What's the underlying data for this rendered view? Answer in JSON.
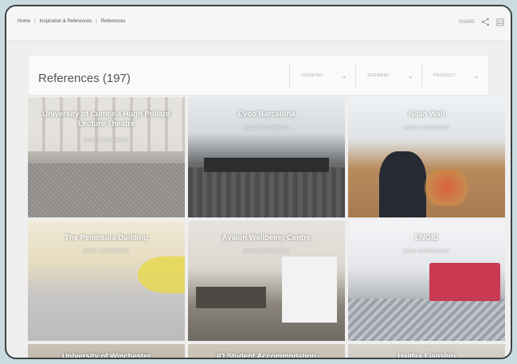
{
  "breadcrumb": [
    "Home",
    "Inspiration & References",
    "References"
  ],
  "top_actions": {
    "share_label": "SHARE"
  },
  "page": {
    "title": "References (197)"
  },
  "filters": [
    {
      "label": "COUNTRY"
    },
    {
      "label": "SEGMENT"
    },
    {
      "label": "PRODUCT"
    }
  ],
  "more_label": "MORE INFORMATION",
  "references": [
    {
      "title": "University of Cumbria Hugh Pollard Lecture Theatre"
    },
    {
      "title": "Evoo Barcelona"
    },
    {
      "title": "Noah Wall"
    },
    {
      "title": "The Peninsula Building"
    },
    {
      "title": "Avalon Wellbeing Centre"
    },
    {
      "title": "ENGIE"
    },
    {
      "title": "University of Winchester"
    },
    {
      "title": "IQ Student Accommodation"
    },
    {
      "title": "Halifax Flagship"
    }
  ]
}
